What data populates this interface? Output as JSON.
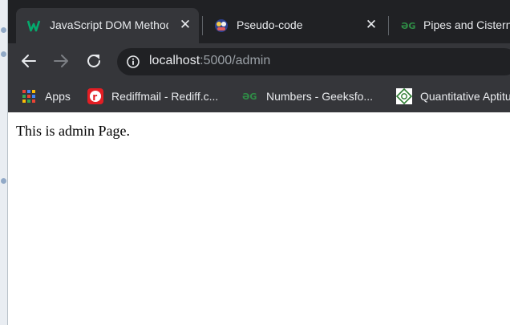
{
  "tabs": [
    {
      "title": "JavaScript DOM Methods",
      "favicon": "w3schools-icon",
      "active": true,
      "close": "✕"
    },
    {
      "title": "Pseudo-code",
      "favicon": "pseudo-code-icon",
      "active": false,
      "close": "✕"
    },
    {
      "title": "Pipes and Cisterns",
      "favicon": "geeksforgeeks-icon",
      "active": false
    }
  ],
  "toolbar": {
    "back": "back-arrow-icon",
    "forward": "forward-arrow-icon",
    "reload": "reload-icon",
    "url_host": "localhost",
    "url_rest": ":5000/admin"
  },
  "bookmarks": [
    {
      "label": "Apps",
      "icon": "apps-grid-icon"
    },
    {
      "label": "Rediffmail - Rediff.c...",
      "icon": "rediffmail-icon"
    },
    {
      "label": "Numbers - Geeksfo...",
      "icon": "geeksforgeeks-icon"
    },
    {
      "label": "Quantitative Aptitude",
      "icon": "quantitative-aptitude-icon"
    }
  ],
  "page": {
    "text": "This is admin Page."
  },
  "colors": {
    "tab_strip": "#202124",
    "toolbar": "#35363a",
    "text": "#e8eaed",
    "muted": "#9aa0a6",
    "gfg_green": "#2f8d46",
    "w3_green": "#04aa6d"
  }
}
